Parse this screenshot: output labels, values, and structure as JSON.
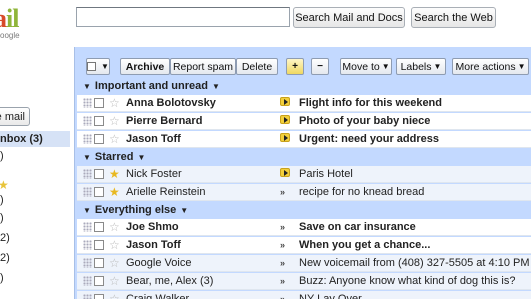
{
  "logo": {
    "text_red": "a",
    "text_rest": "il",
    "sub": "oogle"
  },
  "search": {
    "input_value": "",
    "search_mail_label": "Search Mail and Docs",
    "search_web_label": "Search the Web"
  },
  "sidebar": {
    "compose_label": "e mail",
    "inbox_label": "nbox (3)",
    "fragments": [
      ")",
      ")",
      ")",
      "2)",
      "2)",
      ")"
    ]
  },
  "toolbar": {
    "archive": "Archive",
    "report_spam": "Report spam",
    "delete": "Delete",
    "move_to": "Move to",
    "labels": "Labels",
    "more_actions": "More actions"
  },
  "sections": [
    {
      "title": "Important and unread",
      "rows": [
        {
          "sender": "Anna Bolotovsky",
          "subject": "Flight info for this weekend",
          "unread": true,
          "starred": false,
          "important": "marker"
        },
        {
          "sender": "Pierre Bernard",
          "subject": "Photo of your baby niece",
          "unread": true,
          "starred": false,
          "important": "marker"
        },
        {
          "sender": "Jason Toff",
          "subject": "Urgent: need your address",
          "unread": true,
          "starred": false,
          "important": "marker"
        }
      ]
    },
    {
      "title": "Starred",
      "rows": [
        {
          "sender": "Nick Foster",
          "subject": "Paris Hotel",
          "unread": false,
          "starred": true,
          "important": "marker"
        },
        {
          "sender": "Arielle Reinstein",
          "subject": "recipe for no knead bread",
          "unread": false,
          "starred": true,
          "important": "arrows"
        }
      ]
    },
    {
      "title": "Everything else",
      "rows": [
        {
          "sender": "Joe Shmo",
          "subject": "Save on car insurance",
          "unread": true,
          "starred": false,
          "important": "arrows"
        },
        {
          "sender": "Jason Toff",
          "subject": "When you get a chance...",
          "unread": true,
          "starred": false,
          "important": "arrows"
        },
        {
          "sender": "Google Voice",
          "subject": "New voicemail from (408) 327-5505 at 4:10 PM",
          "unread": false,
          "starred": false,
          "important": "arrows"
        },
        {
          "sender": "Bear, me, Alex (3)",
          "subject": "Buzz: Anyone know what kind of dog this is?",
          "unread": false,
          "starred": false,
          "important": "arrows"
        },
        {
          "sender": "Craig Walker",
          "subject": "NY Lay Over",
          "unread": false,
          "starred": false,
          "important": "arrows"
        }
      ]
    }
  ],
  "colors": {
    "panel_blue": "#c3d9ff",
    "important_marker": "#f2cf3c",
    "star_on": "#e8b820"
  }
}
